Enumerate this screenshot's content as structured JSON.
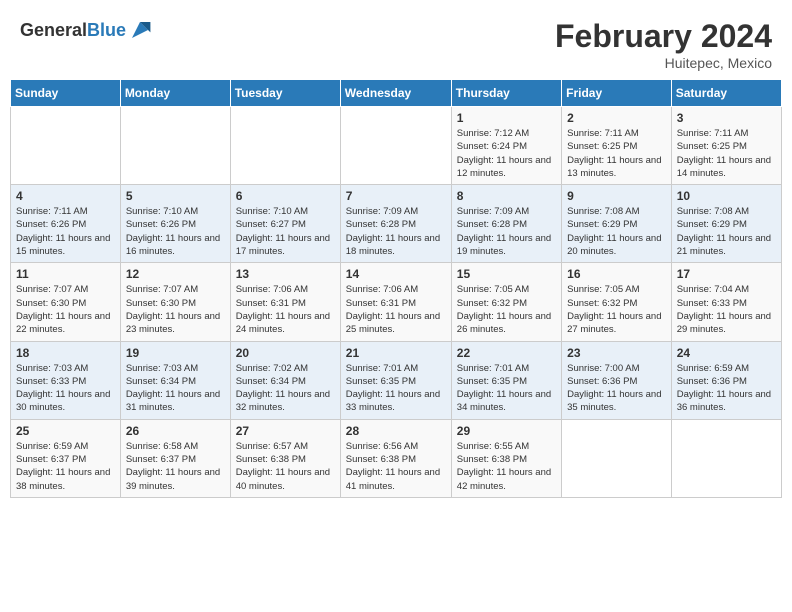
{
  "header": {
    "logo_general": "General",
    "logo_blue": "Blue",
    "title": "February 2024",
    "subtitle": "Huitepec, Mexico"
  },
  "weekdays": [
    "Sunday",
    "Monday",
    "Tuesday",
    "Wednesday",
    "Thursday",
    "Friday",
    "Saturday"
  ],
  "weeks": [
    [
      {
        "day": "",
        "info": ""
      },
      {
        "day": "",
        "info": ""
      },
      {
        "day": "",
        "info": ""
      },
      {
        "day": "",
        "info": ""
      },
      {
        "day": "1",
        "info": "Sunrise: 7:12 AM\nSunset: 6:24 PM\nDaylight: 11 hours and 12 minutes."
      },
      {
        "day": "2",
        "info": "Sunrise: 7:11 AM\nSunset: 6:25 PM\nDaylight: 11 hours and 13 minutes."
      },
      {
        "day": "3",
        "info": "Sunrise: 7:11 AM\nSunset: 6:25 PM\nDaylight: 11 hours and 14 minutes."
      }
    ],
    [
      {
        "day": "4",
        "info": "Sunrise: 7:11 AM\nSunset: 6:26 PM\nDaylight: 11 hours and 15 minutes."
      },
      {
        "day": "5",
        "info": "Sunrise: 7:10 AM\nSunset: 6:26 PM\nDaylight: 11 hours and 16 minutes."
      },
      {
        "day": "6",
        "info": "Sunrise: 7:10 AM\nSunset: 6:27 PM\nDaylight: 11 hours and 17 minutes."
      },
      {
        "day": "7",
        "info": "Sunrise: 7:09 AM\nSunset: 6:28 PM\nDaylight: 11 hours and 18 minutes."
      },
      {
        "day": "8",
        "info": "Sunrise: 7:09 AM\nSunset: 6:28 PM\nDaylight: 11 hours and 19 minutes."
      },
      {
        "day": "9",
        "info": "Sunrise: 7:08 AM\nSunset: 6:29 PM\nDaylight: 11 hours and 20 minutes."
      },
      {
        "day": "10",
        "info": "Sunrise: 7:08 AM\nSunset: 6:29 PM\nDaylight: 11 hours and 21 minutes."
      }
    ],
    [
      {
        "day": "11",
        "info": "Sunrise: 7:07 AM\nSunset: 6:30 PM\nDaylight: 11 hours and 22 minutes."
      },
      {
        "day": "12",
        "info": "Sunrise: 7:07 AM\nSunset: 6:30 PM\nDaylight: 11 hours and 23 minutes."
      },
      {
        "day": "13",
        "info": "Sunrise: 7:06 AM\nSunset: 6:31 PM\nDaylight: 11 hours and 24 minutes."
      },
      {
        "day": "14",
        "info": "Sunrise: 7:06 AM\nSunset: 6:31 PM\nDaylight: 11 hours and 25 minutes."
      },
      {
        "day": "15",
        "info": "Sunrise: 7:05 AM\nSunset: 6:32 PM\nDaylight: 11 hours and 26 minutes."
      },
      {
        "day": "16",
        "info": "Sunrise: 7:05 AM\nSunset: 6:32 PM\nDaylight: 11 hours and 27 minutes."
      },
      {
        "day": "17",
        "info": "Sunrise: 7:04 AM\nSunset: 6:33 PM\nDaylight: 11 hours and 29 minutes."
      }
    ],
    [
      {
        "day": "18",
        "info": "Sunrise: 7:03 AM\nSunset: 6:33 PM\nDaylight: 11 hours and 30 minutes."
      },
      {
        "day": "19",
        "info": "Sunrise: 7:03 AM\nSunset: 6:34 PM\nDaylight: 11 hours and 31 minutes."
      },
      {
        "day": "20",
        "info": "Sunrise: 7:02 AM\nSunset: 6:34 PM\nDaylight: 11 hours and 32 minutes."
      },
      {
        "day": "21",
        "info": "Sunrise: 7:01 AM\nSunset: 6:35 PM\nDaylight: 11 hours and 33 minutes."
      },
      {
        "day": "22",
        "info": "Sunrise: 7:01 AM\nSunset: 6:35 PM\nDaylight: 11 hours and 34 minutes."
      },
      {
        "day": "23",
        "info": "Sunrise: 7:00 AM\nSunset: 6:36 PM\nDaylight: 11 hours and 35 minutes."
      },
      {
        "day": "24",
        "info": "Sunrise: 6:59 AM\nSunset: 6:36 PM\nDaylight: 11 hours and 36 minutes."
      }
    ],
    [
      {
        "day": "25",
        "info": "Sunrise: 6:59 AM\nSunset: 6:37 PM\nDaylight: 11 hours and 38 minutes."
      },
      {
        "day": "26",
        "info": "Sunrise: 6:58 AM\nSunset: 6:37 PM\nDaylight: 11 hours and 39 minutes."
      },
      {
        "day": "27",
        "info": "Sunrise: 6:57 AM\nSunset: 6:38 PM\nDaylight: 11 hours and 40 minutes."
      },
      {
        "day": "28",
        "info": "Sunrise: 6:56 AM\nSunset: 6:38 PM\nDaylight: 11 hours and 41 minutes."
      },
      {
        "day": "29",
        "info": "Sunrise: 6:55 AM\nSunset: 6:38 PM\nDaylight: 11 hours and 42 minutes."
      },
      {
        "day": "",
        "info": ""
      },
      {
        "day": "",
        "info": ""
      }
    ]
  ]
}
